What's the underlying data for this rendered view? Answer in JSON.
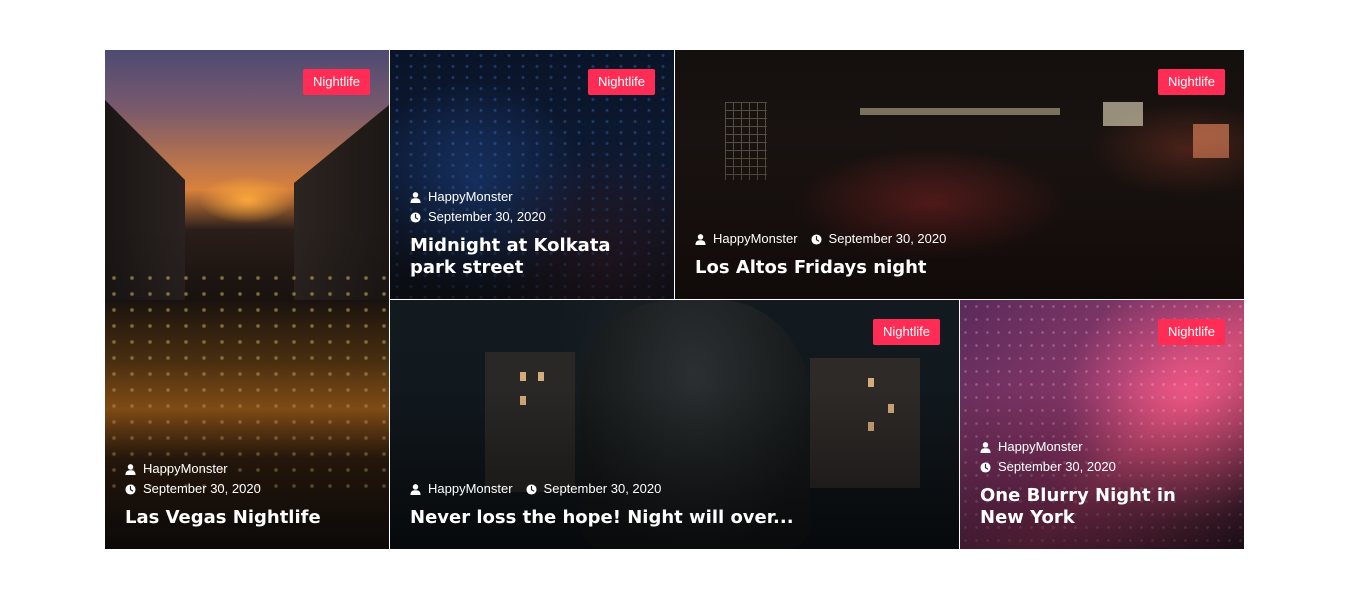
{
  "colors": {
    "badge": "#ff2d55"
  },
  "icons": {
    "author": "user-icon",
    "date": "clock-icon"
  },
  "posts": [
    {
      "category": "Nightlife",
      "author": "HappyMonster",
      "date": "September 30, 2020",
      "title": "Las Vegas Nightlife"
    },
    {
      "category": "Nightlife",
      "author": "HappyMonster",
      "date": "September 30, 2020",
      "title": "Midnight at Kolkata park street"
    },
    {
      "category": "Nightlife",
      "author": "HappyMonster",
      "date": "September 30, 2020",
      "title": "Los Altos Fridays night"
    },
    {
      "category": "Nightlife",
      "author": "HappyMonster",
      "date": "September 30, 2020",
      "title": "Never loss the hope! Night will over..."
    },
    {
      "category": "Nightlife",
      "author": "HappyMonster",
      "date": "September 30, 2020",
      "title": "One Blurry Night in New York"
    }
  ]
}
